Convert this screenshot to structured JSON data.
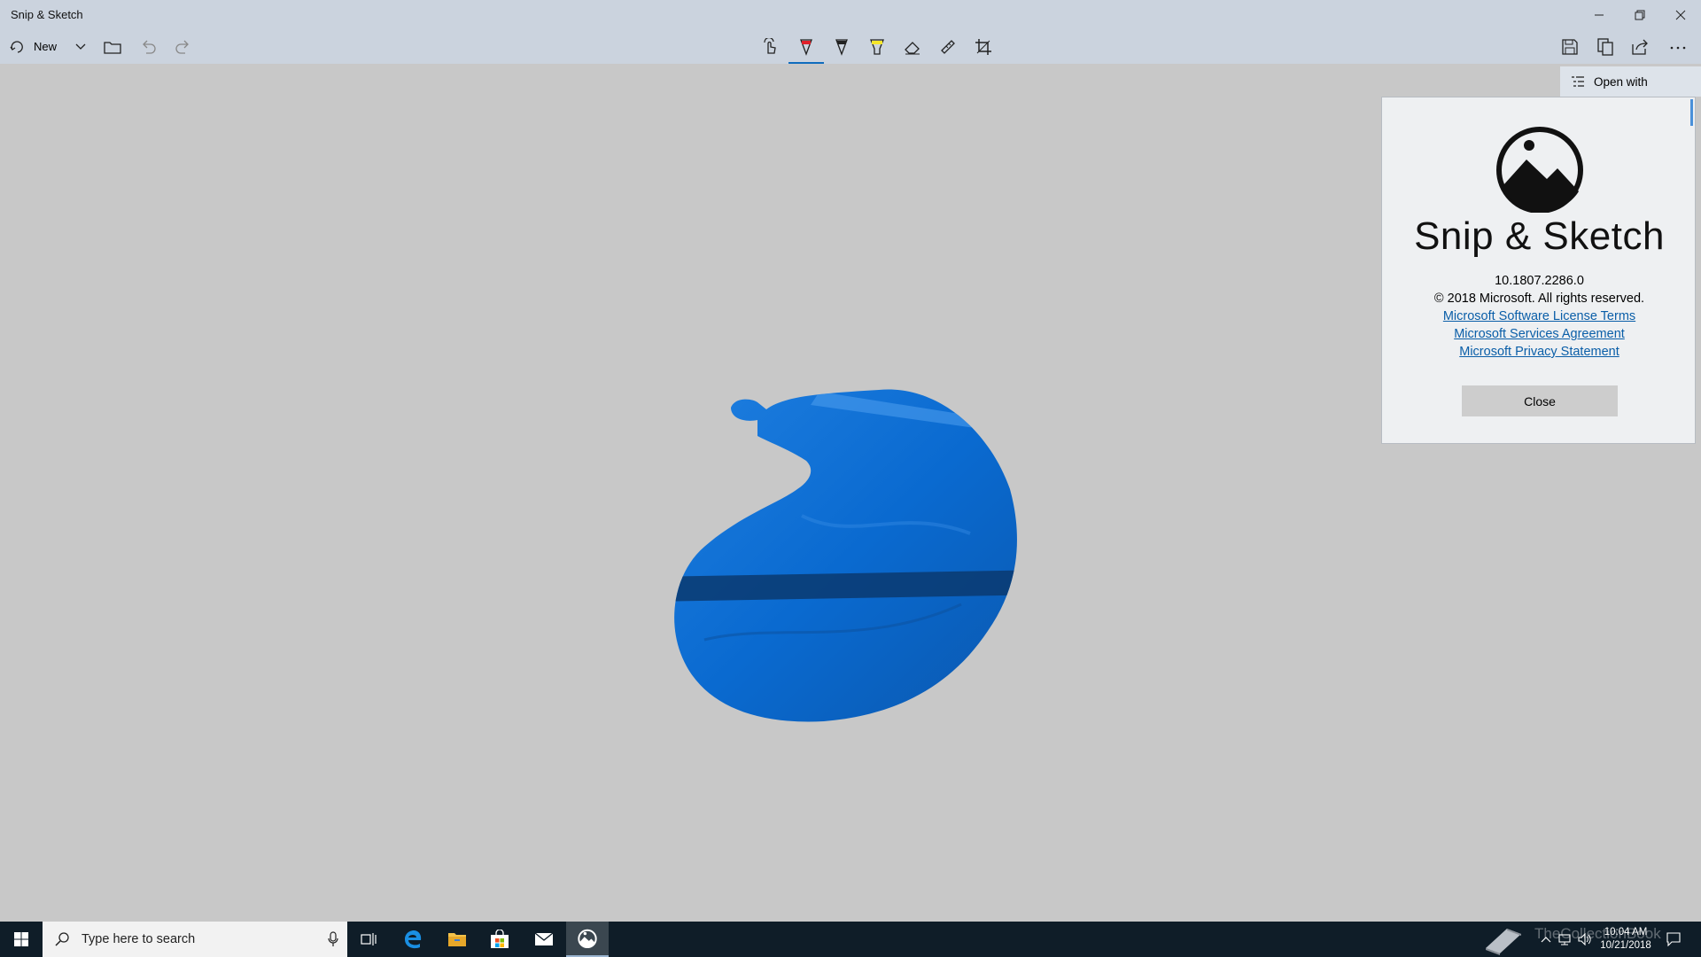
{
  "window": {
    "title": "Snip & Sketch"
  },
  "toolbar": {
    "new_label": "New"
  },
  "flyout": {
    "open_with_label": "Open with"
  },
  "about": {
    "app_name": "Snip & Sketch",
    "version": "10.1807.2286.0",
    "copyright": "© 2018 Microsoft. All rights reserved.",
    "links": [
      "Microsoft Software License Terms",
      "Microsoft Services Agreement",
      "Microsoft Privacy Statement"
    ],
    "close_label": "Close"
  },
  "taskbar": {
    "search_placeholder": "Type here to search",
    "watermark": "TheCollectionBook",
    "time": "10:04 AM",
    "date": "10/21/2018"
  },
  "colors": {
    "titlebar": "#cbd3de",
    "canvas": "#c8c8c8",
    "snip_blue": "#0a6ad0",
    "accent": "#0f6cbd",
    "taskbar": "#0f1d28"
  }
}
